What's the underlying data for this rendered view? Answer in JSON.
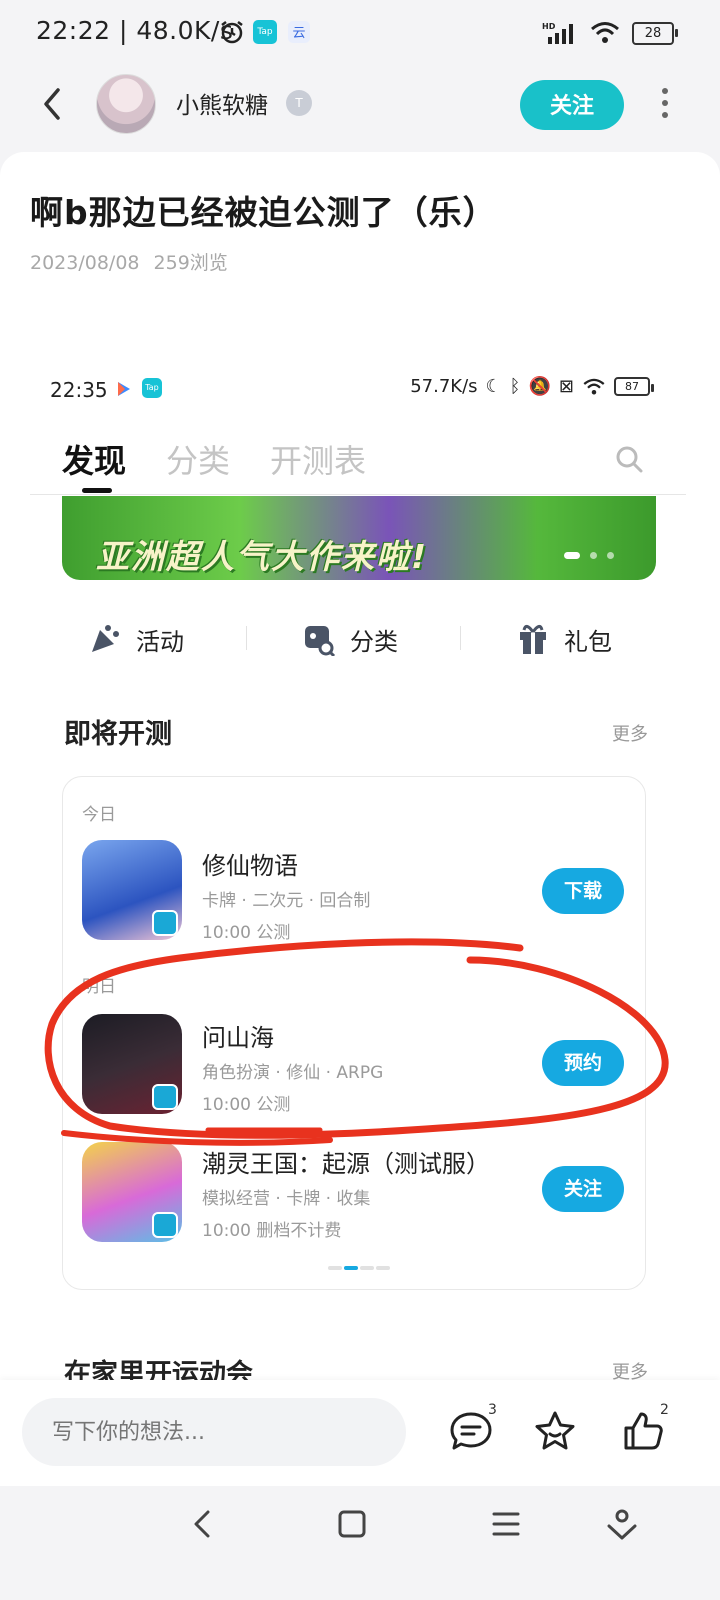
{
  "status_bar": {
    "time": "22:22 | 48.0K/s",
    "tap_label": "Tap",
    "network": "HD",
    "battery": "28"
  },
  "header": {
    "author": "小熊软糖",
    "level_badge": "T",
    "follow_label": "关注"
  },
  "post": {
    "title": "啊b那边已经被迫公测了（乐）",
    "date": "2023/08/08",
    "views": "259浏览"
  },
  "screenshot": {
    "status": {
      "time": "22:35",
      "tap_label": "Tap",
      "speed": "57.7K/s",
      "battery": "87"
    },
    "tabs": [
      {
        "label": "发现"
      },
      {
        "label": "分类"
      },
      {
        "label": "开测表"
      }
    ],
    "banner_text": "亚洲超人气大作来啦!",
    "quick_links": [
      {
        "label": "活动"
      },
      {
        "label": "分类"
      },
      {
        "label": "礼包"
      }
    ],
    "section_title": "即将开测",
    "section_more": "更多",
    "days": {
      "today": "今日",
      "tomorrow": "明日"
    },
    "games": [
      {
        "name": "修仙物语",
        "tags": "卡牌 · 二次元 · 回合制",
        "time": "10:00 公测",
        "button": "下载"
      },
      {
        "name": "问山海",
        "tags": "角色扮演 · 修仙 · ARPG",
        "time": "10:00 公测",
        "button": "预约"
      },
      {
        "name": "潮灵王国：起源（测试服）",
        "tags": "模拟经营 · 卡牌 · 收集",
        "time": "10:00 删档不计费",
        "button": "关注"
      }
    ],
    "section2_title": "在家里开运动会",
    "section2_more": "更多"
  },
  "bottom_bar": {
    "comment_placeholder": "写下你的想法...",
    "comment_count": "3",
    "like_count": "2"
  },
  "colors": {
    "accent_teal": "#19c1c9",
    "accent_blue": "#16a9e1",
    "annotation_red": "#e8321e"
  }
}
